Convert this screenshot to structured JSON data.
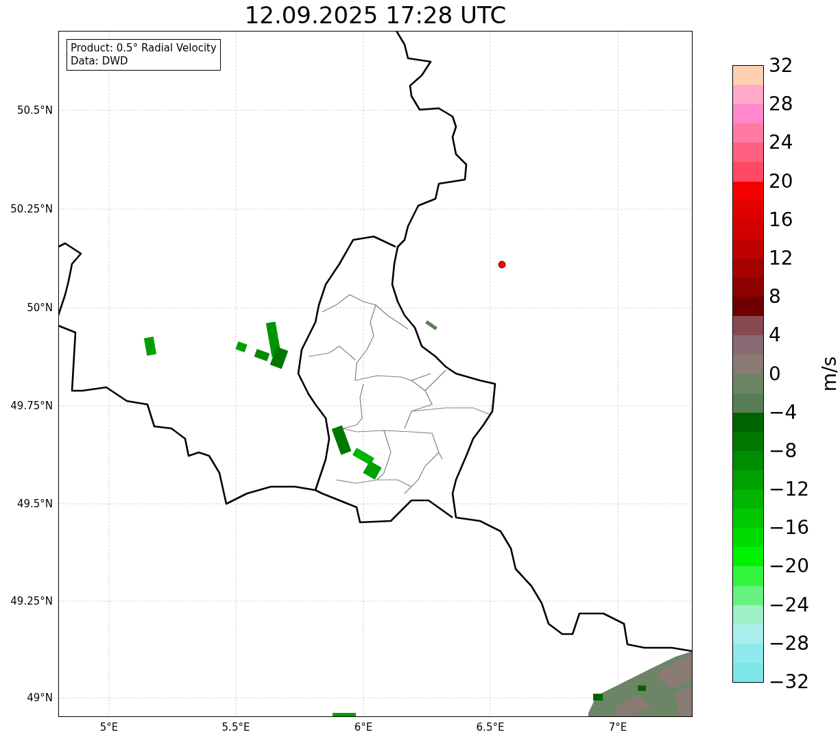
{
  "title": "12.09.2025 17:28 UTC",
  "legend": {
    "lines": [
      "Product: 0.5° Radial Velocity",
      "Data: DWD"
    ]
  },
  "map": {
    "lat_ticks": [
      "50.5°N",
      "50.25°N",
      "50°N",
      "49.75°N",
      "49.5°N",
      "49.25°N",
      "49°N"
    ],
    "lon_ticks": [
      "5°E",
      "5.5°E",
      "6°E",
      "6.5°E",
      "7°E"
    ]
  },
  "colorbar": {
    "label": "m/s",
    "ticks": [
      "32",
      "28",
      "24",
      "20",
      "16",
      "12",
      "8",
      "4",
      "0",
      "−4",
      "−8",
      "−12",
      "−16",
      "−20",
      "−24",
      "−28",
      "−32"
    ],
    "bins": [
      {
        "color": "#7ae6e8"
      },
      {
        "color": "#8eeaec"
      },
      {
        "color": "#aaeeee"
      },
      {
        "color": "#9ff2c8"
      },
      {
        "color": "#66f27e"
      },
      {
        "color": "#33f53e"
      },
      {
        "color": "#00f200"
      },
      {
        "color": "#00dc00"
      },
      {
        "color": "#00c800"
      },
      {
        "color": "#00b400"
      },
      {
        "color": "#00a000"
      },
      {
        "color": "#008c00"
      },
      {
        "color": "#007800"
      },
      {
        "color": "#006400"
      },
      {
        "color": "#5a7d55"
      },
      {
        "color": "#6b8566"
      },
      {
        "color": "#8a7a74"
      },
      {
        "color": "#8a6a72"
      },
      {
        "color": "#864a50"
      },
      {
        "color": "#6e0000"
      },
      {
        "color": "#8c0000"
      },
      {
        "color": "#a50000"
      },
      {
        "color": "#be0000"
      },
      {
        "color": "#d20000"
      },
      {
        "color": "#e00000"
      },
      {
        "color": "#f50000"
      },
      {
        "color": "#ff4a64"
      },
      {
        "color": "#ff6080"
      },
      {
        "color": "#ff7aa0"
      },
      {
        "color": "#ff88cc"
      },
      {
        "color": "#ffa8c8"
      },
      {
        "color": "#ffd0b0"
      }
    ]
  }
}
